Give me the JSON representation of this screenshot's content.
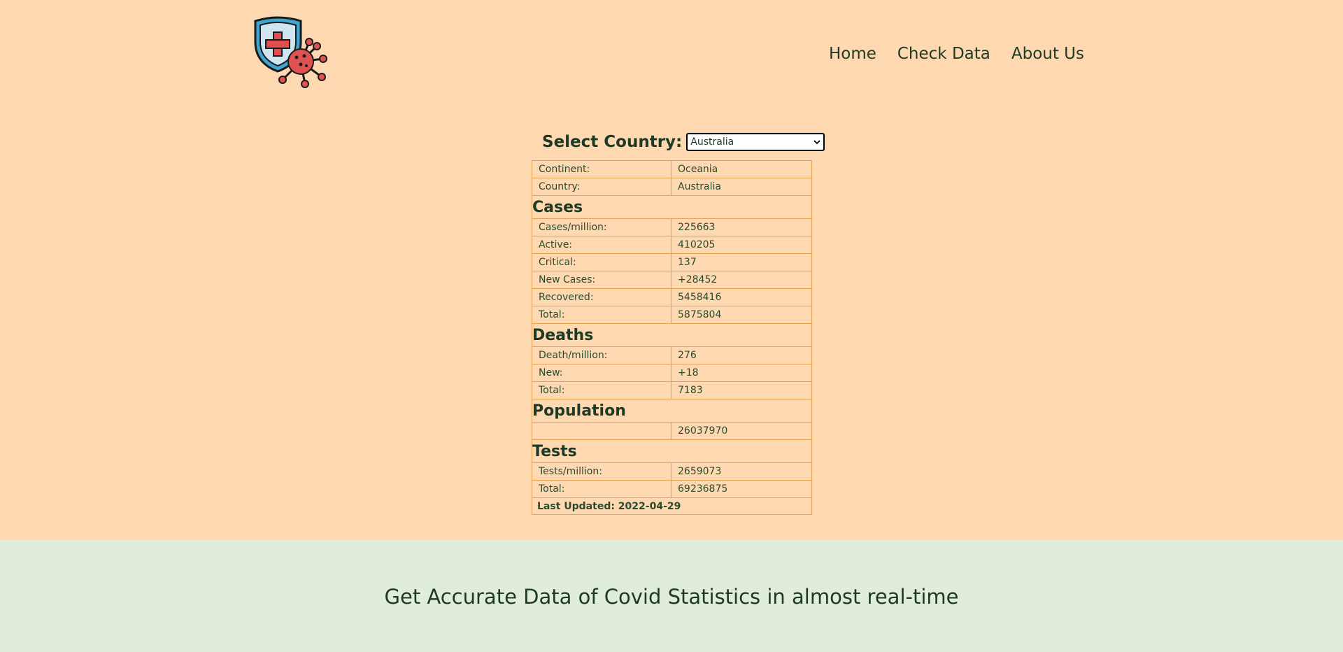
{
  "nav": {
    "home": "Home",
    "check_data": "Check Data",
    "about_us": "About Us"
  },
  "selector": {
    "label": "Select Country:",
    "value": "Australia"
  },
  "info": {
    "continent": {
      "label": "Continent:",
      "value": "Oceania"
    },
    "country": {
      "label": "Country:",
      "value": "Australia"
    }
  },
  "cases": {
    "heading": "Cases",
    "per_million": {
      "label": "Cases/million:",
      "value": "225663"
    },
    "active": {
      "label": "Active:",
      "value": "410205"
    },
    "critical": {
      "label": "Critical:",
      "value": "137"
    },
    "new": {
      "label": "New Cases:",
      "value": "+28452"
    },
    "recovered": {
      "label": "Recovered:",
      "value": "5458416"
    },
    "total": {
      "label": "Total:",
      "value": "5875804"
    }
  },
  "deaths": {
    "heading": "Deaths",
    "per_million": {
      "label": "Death/million:",
      "value": "276"
    },
    "new": {
      "label": "New:",
      "value": "+18"
    },
    "total": {
      "label": "Total:",
      "value": "7183"
    }
  },
  "population": {
    "heading": "Population",
    "value": "26037970"
  },
  "tests": {
    "heading": "Tests",
    "per_million": {
      "label": "Tests/million:",
      "value": "2659073"
    },
    "total": {
      "label": "Total:",
      "value": "69236875"
    }
  },
  "last_updated": "Last Updated: 2022-04-29",
  "tagline": "Get Accurate Data of Covid Statistics in almost real-time",
  "colors": {
    "header_bg": "#fdd8b1",
    "footer_bg": "#e0eddc",
    "text": "#1f3a24",
    "table_border": "#e8a251"
  }
}
